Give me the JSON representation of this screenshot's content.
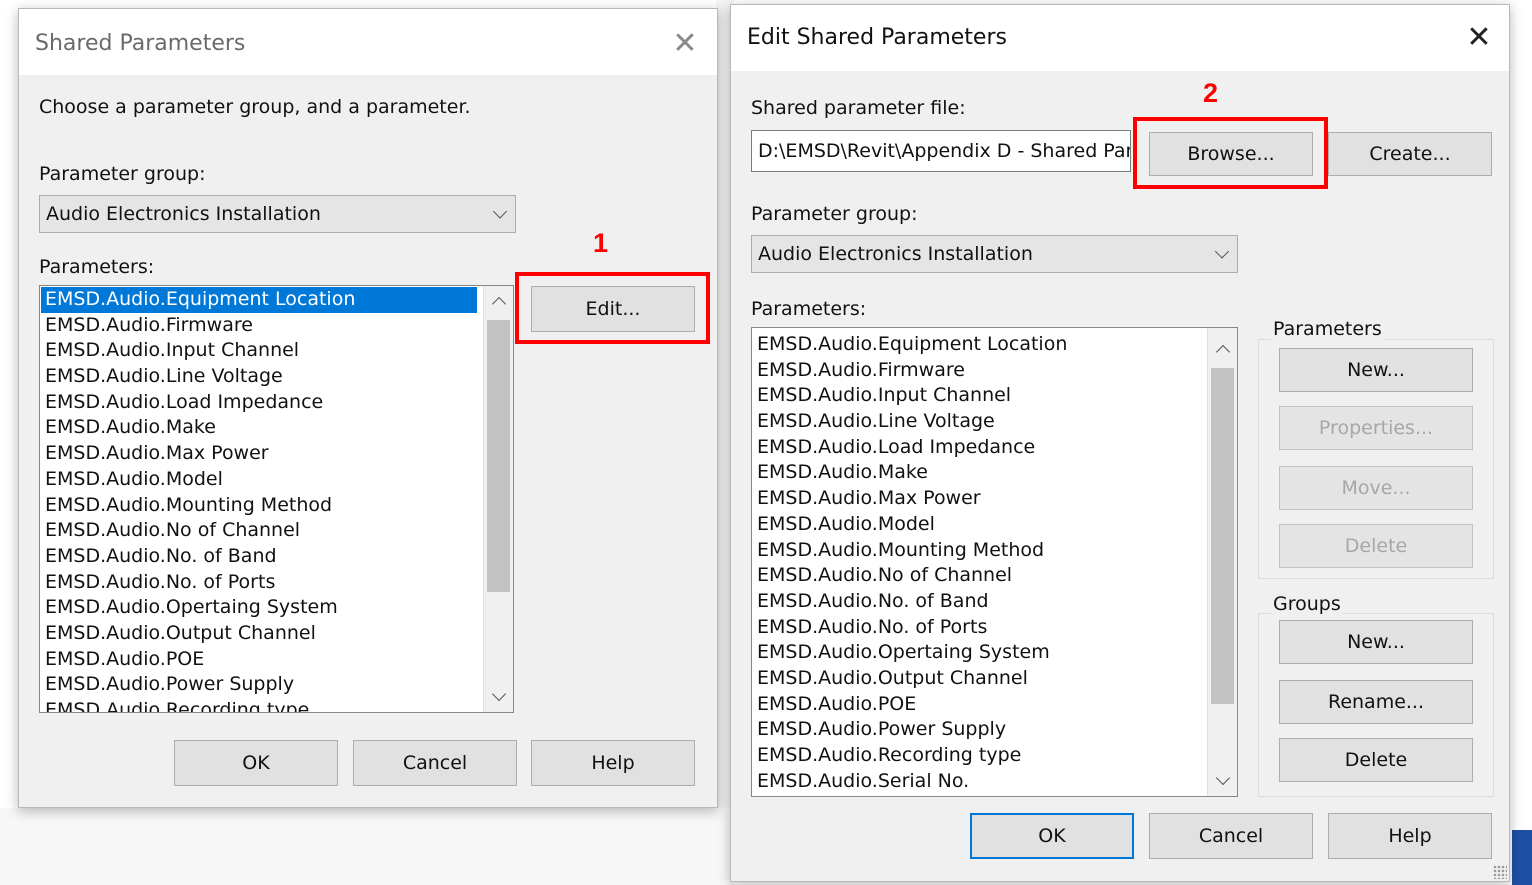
{
  "shared_parameters_dialog": {
    "title": "Shared Parameters",
    "instruction": "Choose a parameter group, and a parameter.",
    "parameter_group_label": "Parameter group:",
    "parameter_group_value": "Audio Electronics Installation",
    "parameters_label": "Parameters:",
    "parameters": [
      "EMSD.Audio.Equipment Location",
      "EMSD.Audio.Firmware",
      "EMSD.Audio.Input Channel",
      "EMSD.Audio.Line Voltage",
      "EMSD.Audio.Load Impedance",
      "EMSD.Audio.Make",
      "EMSD.Audio.Max Power",
      "EMSD.Audio.Model",
      "EMSD.Audio.Mounting Method",
      "EMSD.Audio.No of Channel",
      "EMSD.Audio.No. of Band",
      "EMSD.Audio.No. of Ports",
      "EMSD.Audio.Opertaing System",
      "EMSD.Audio.Output Channel",
      "EMSD.Audio.POE",
      "EMSD.Audio.Power Supply",
      "EMSD.Audio.Recording type"
    ],
    "selected_parameter": "EMSD.Audio.Equipment Location",
    "edit_button": "Edit...",
    "ok_button": "OK",
    "cancel_button": "Cancel",
    "help_button": "Help",
    "callout_number": "1"
  },
  "edit_shared_parameters_dialog": {
    "title": "Edit Shared Parameters",
    "shared_file_label": "Shared parameter file:",
    "shared_file_value": "D:\\EMSD\\Revit\\Appendix D - Shared Par",
    "browse_button": "Browse...",
    "create_button": "Create...",
    "parameter_group_label": "Parameter group:",
    "parameter_group_value": "Audio Electronics Installation",
    "parameters_label": "Parameters:",
    "parameters": [
      "EMSD.Audio.Equipment Location",
      "EMSD.Audio.Firmware",
      "EMSD.Audio.Input Channel",
      "EMSD.Audio.Line Voltage",
      "EMSD.Audio.Load Impedance",
      "EMSD.Audio.Make",
      "EMSD.Audio.Max Power",
      "EMSD.Audio.Model",
      "EMSD.Audio.Mounting Method",
      "EMSD.Audio.No of Channel",
      "EMSD.Audio.No. of Band",
      "EMSD.Audio.No. of Ports",
      "EMSD.Audio.Opertaing System",
      "EMSD.Audio.Output Channel",
      "EMSD.Audio.POE",
      "EMSD.Audio.Power Supply",
      "EMSD.Audio.Recording type",
      "EMSD.Audio.Serial No."
    ],
    "parameters_group_title": "Parameters",
    "param_new_button": "New...",
    "param_properties_button": "Properties...",
    "param_move_button": "Move...",
    "param_delete_button": "Delete",
    "groups_group_title": "Groups",
    "group_new_button": "New...",
    "group_rename_button": "Rename...",
    "group_delete_button": "Delete",
    "ok_button": "OK",
    "cancel_button": "Cancel",
    "help_button": "Help",
    "callout_number": "2"
  },
  "colors": {
    "callout": "#ff0000",
    "selection": "#0078d7",
    "dialog_bg": "#f0f0f0"
  }
}
